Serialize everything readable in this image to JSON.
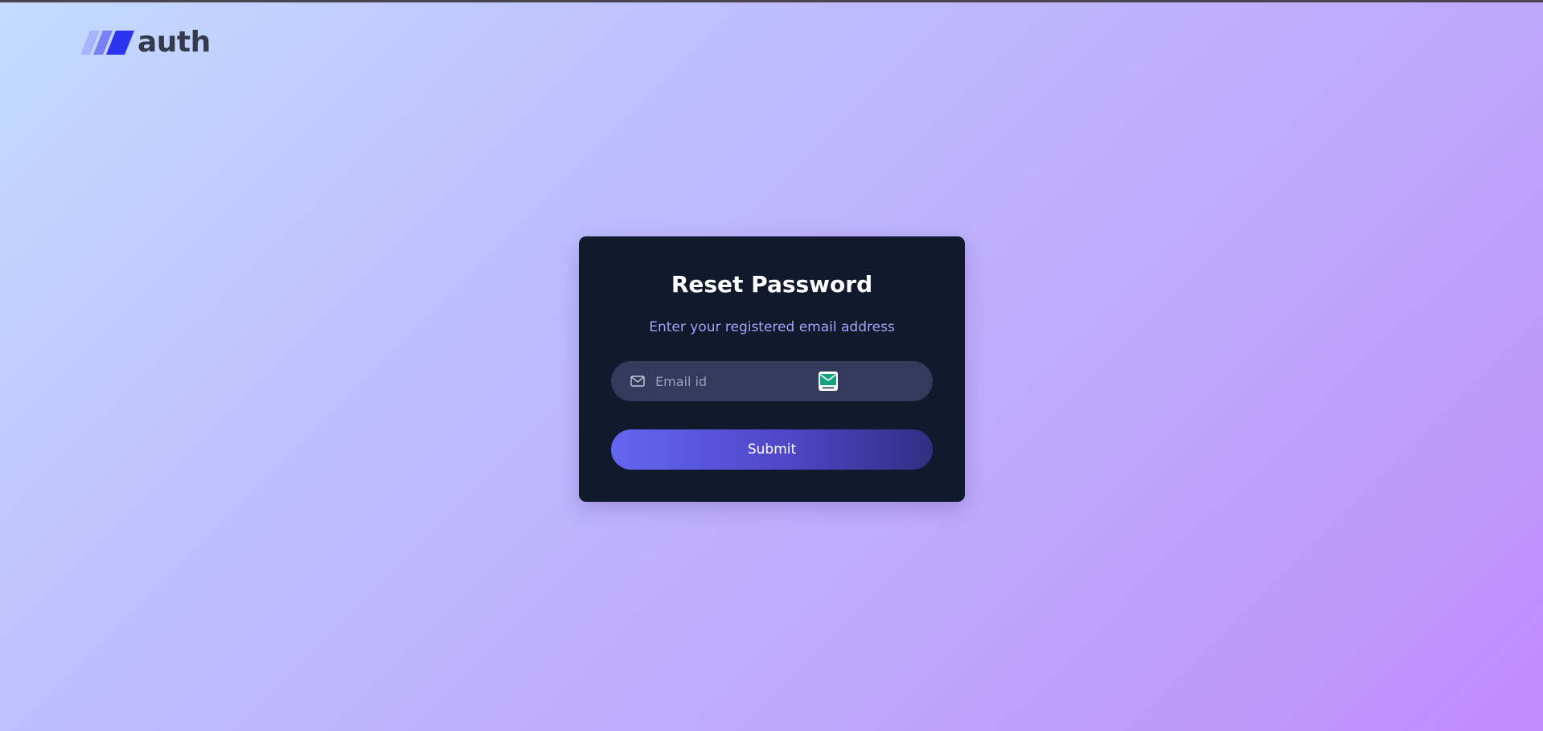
{
  "brand": {
    "name": "auth",
    "logo_icon": "three-slanted-bars-logo-icon",
    "colors": {
      "bar_light": "#a5b4fc",
      "bar_mid": "#6366f1",
      "bar_dark": "#2b34f0",
      "text": "#343a4b"
    }
  },
  "card": {
    "title": "Reset Password",
    "subtitle": "Enter your registered email address"
  },
  "email_field": {
    "icon": "mail-icon",
    "placeholder": "Email id",
    "value": "",
    "extension_icon": "tempmail-extension-icon"
  },
  "submit_button": {
    "label": "Submit"
  },
  "colors": {
    "card_background": "#111a2c",
    "input_background": "#333a5b",
    "subtitle_color": "#a7a1f7",
    "button_gradient_start": "#6366f1",
    "button_gradient_end": "#312e81"
  }
}
